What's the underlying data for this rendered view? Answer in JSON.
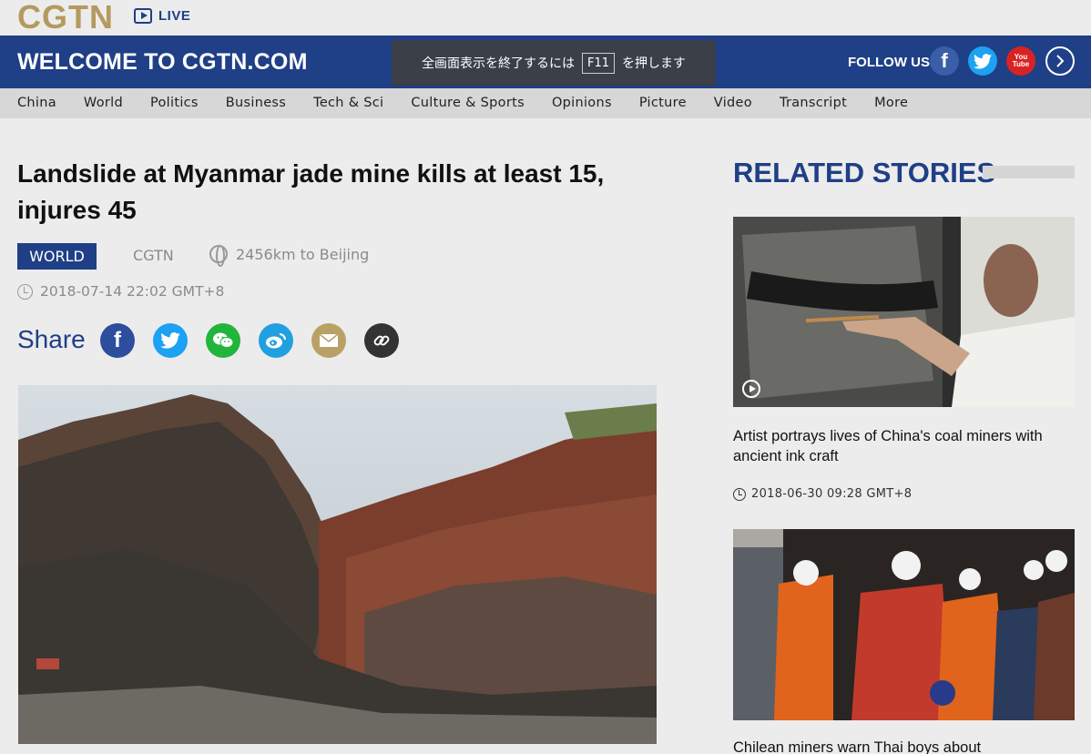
{
  "header": {
    "logo": "CGTN",
    "live_label": "LIVE",
    "welcome": "WELCOME TO CGTN.COM",
    "fullscreen_notice": {
      "before": "全画面表示を終了するには",
      "key": "F11",
      "after": "を押します"
    },
    "follow_label": "FOLLOW US",
    "social_icons": [
      "facebook-icon",
      "twitter-icon",
      "youtube-icon",
      "chevron-right-icon"
    ],
    "youtube_text": "You Tube"
  },
  "nav": {
    "items": [
      "China",
      "World",
      "Politics",
      "Business",
      "Tech & Sci",
      "Culture & Sports",
      "Opinions",
      "Picture",
      "Video",
      "Transcript",
      "More"
    ]
  },
  "article": {
    "title": "Landslide at Myanmar jade mine kills at least 15, injures 45",
    "category": "WORLD",
    "source": "CGTN",
    "distance": "2456km to Beijing",
    "datetime": "2018-07-14 22:02 GMT+8",
    "share_label": "Share",
    "share_icons": [
      "facebook-icon",
      "twitter-icon",
      "wechat-icon",
      "weibo-icon",
      "mail-icon",
      "link-icon"
    ]
  },
  "related": {
    "title": "RELATED STORIES",
    "stories": [
      {
        "title": "Artist portrays lives of China's coal miners with ancient ink craft",
        "datetime": "2018-06-30 09:28 GMT+8"
      },
      {
        "title": "Chilean miners warn Thai boys about"
      }
    ]
  },
  "colors": {
    "brand_blue": "#1f3f86",
    "brand_gold": "#b49a5e",
    "background": "#ececec",
    "nav_bg": "#d7d7d7"
  }
}
